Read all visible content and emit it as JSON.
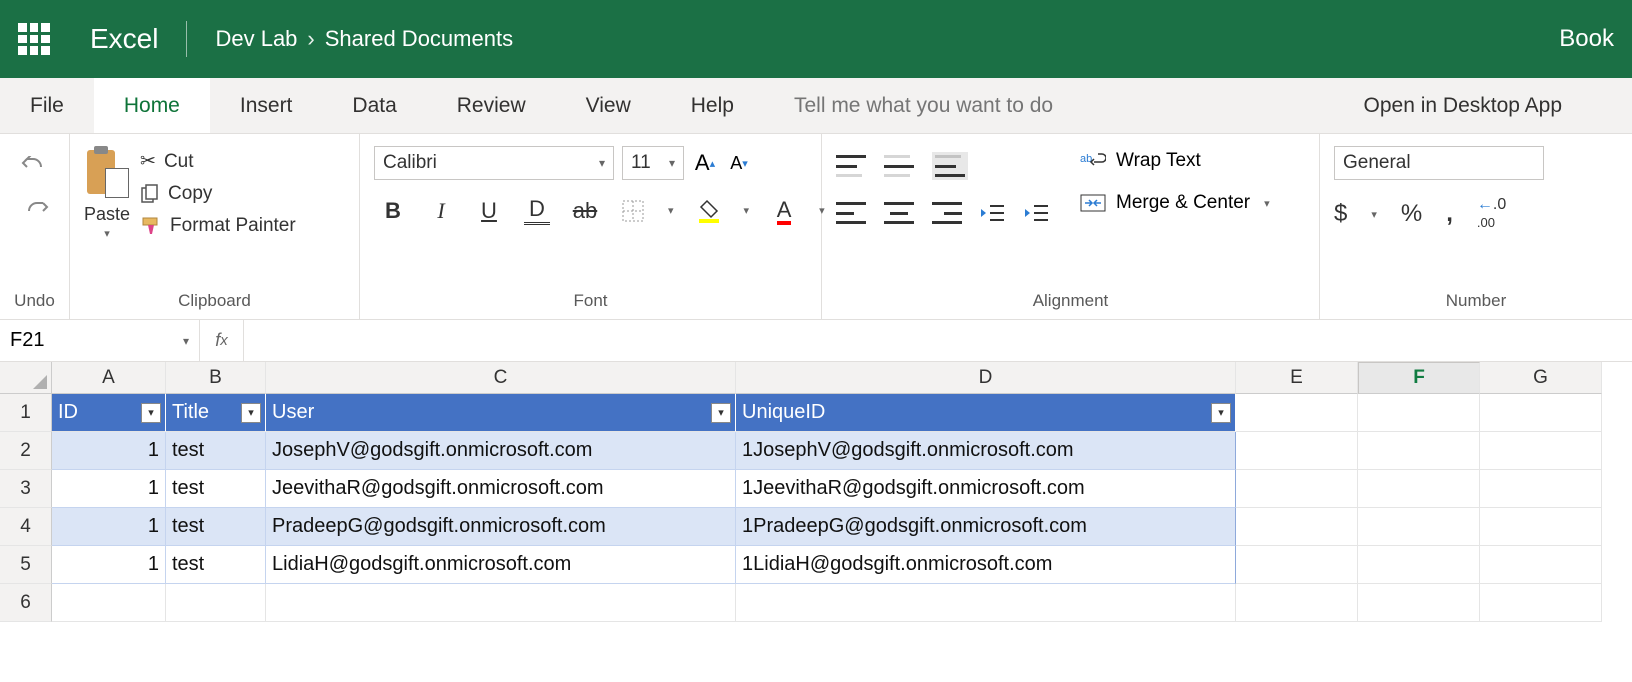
{
  "titlebar": {
    "app_name": "Excel",
    "breadcrumb1": "Dev Lab",
    "breadcrumb2": "Shared Documents",
    "doc_title": "Book"
  },
  "tabs": {
    "file": "File",
    "home": "Home",
    "insert": "Insert",
    "data": "Data",
    "review": "Review",
    "view": "View",
    "help": "Help",
    "tell_me": "Tell me what you want to do",
    "desktop": "Open in Desktop App"
  },
  "ribbon": {
    "undo_label": "Undo",
    "clipboard": {
      "paste": "Paste",
      "cut": "Cut",
      "copy": "Copy",
      "format_painter": "Format Painter",
      "label": "Clipboard"
    },
    "font": {
      "name": "Calibri",
      "size": "11",
      "label": "Font"
    },
    "alignment": {
      "wrap": "Wrap Text",
      "merge": "Merge & Center",
      "label": "Alignment"
    },
    "number": {
      "format": "General",
      "label": "Number"
    }
  },
  "namebox": "F21",
  "columns": [
    "A",
    "B",
    "C",
    "D",
    "E",
    "F",
    "G"
  ],
  "row_numbers": [
    "1",
    "2",
    "3",
    "4",
    "5",
    "6"
  ],
  "table": {
    "headers": {
      "A": "ID",
      "B": "Title",
      "C": "User",
      "D": "UniqueID"
    },
    "rows": [
      {
        "A": "1",
        "B": "test",
        "C": "JosephV@godsgift.onmicrosoft.com",
        "D": "1JosephV@godsgift.onmicrosoft.com"
      },
      {
        "A": "1",
        "B": "test",
        "C": "JeevithaR@godsgift.onmicrosoft.com",
        "D": "1JeevithaR@godsgift.onmicrosoft.com"
      },
      {
        "A": "1",
        "B": "test",
        "C": "PradeepG@godsgift.onmicrosoft.com",
        "D": "1PradeepG@godsgift.onmicrosoft.com"
      },
      {
        "A": "1",
        "B": "test",
        "C": "LidiaH@godsgift.onmicrosoft.com",
        "D": "1LidiaH@godsgift.onmicrosoft.com"
      }
    ]
  },
  "col_widths": {
    "A": 114,
    "B": 100,
    "C": 470,
    "D": 500,
    "E": 122,
    "F": 122,
    "G": 122
  },
  "selected_col": "F"
}
